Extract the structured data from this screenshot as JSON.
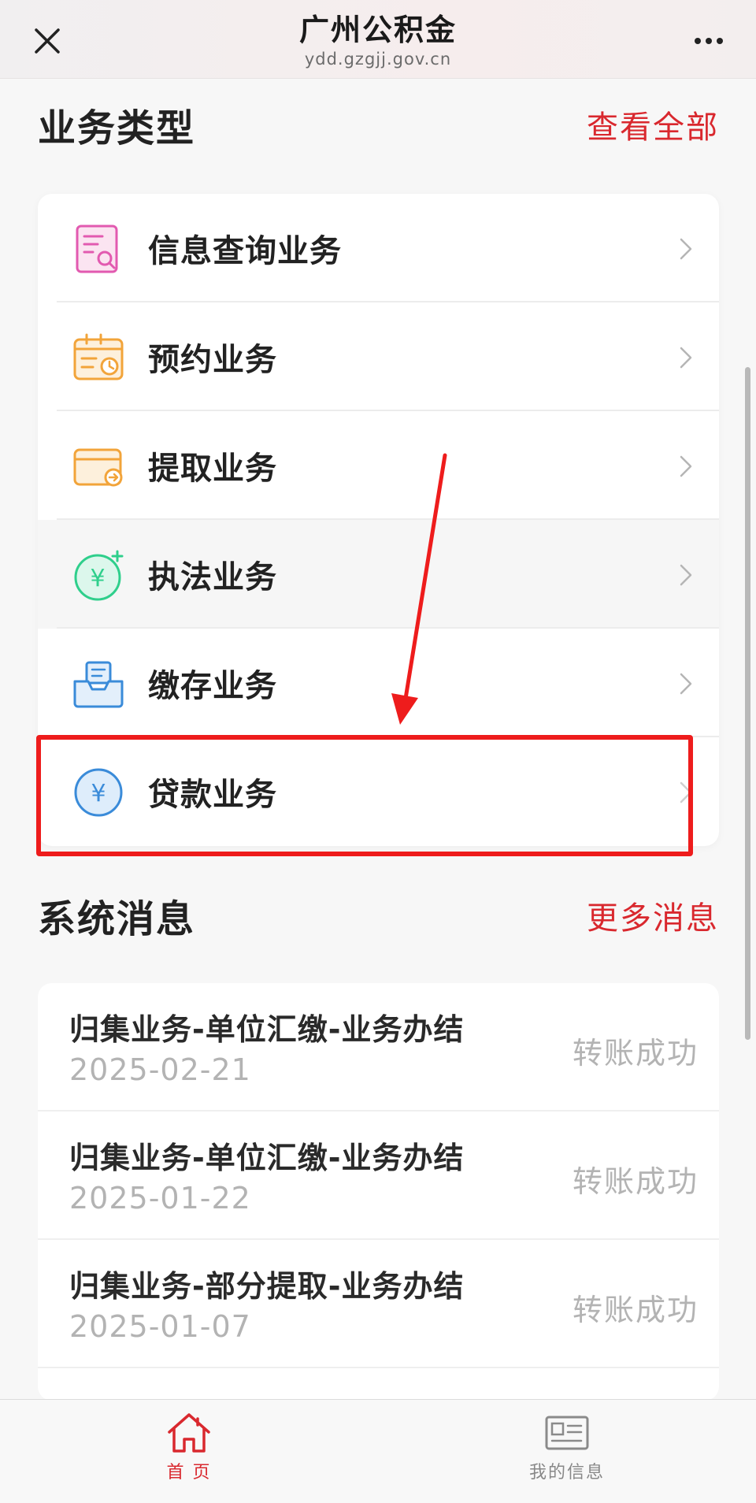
{
  "header": {
    "title": "广州公积金",
    "url": "ydd.gzgjj.gov.cn"
  },
  "business": {
    "title": "业务类型",
    "view_all": "查看全部",
    "items": [
      {
        "label": "信息查询业务",
        "icon": "document-search-icon"
      },
      {
        "label": "预约业务",
        "icon": "calendar-clock-icon"
      },
      {
        "label": "提取业务",
        "icon": "card-withdraw-icon"
      },
      {
        "label": "执法业务",
        "icon": "yuan-plus-circle-icon"
      },
      {
        "label": "缴存业务",
        "icon": "inbox-tray-icon"
      },
      {
        "label": "贷款业务",
        "icon": "yuan-circle-icon"
      }
    ]
  },
  "messages": {
    "title": "系统消息",
    "more": "更多消息",
    "items": [
      {
        "title": "归集业务-单位汇缴-业务办结",
        "date": "2025-02-21",
        "status": "转账成功"
      },
      {
        "title": "归集业务-单位汇缴-业务办结",
        "date": "2025-01-22",
        "status": "转账成功"
      },
      {
        "title": "归集业务-部分提取-业务办结",
        "date": "2025-01-07",
        "status": "转账成功"
      }
    ]
  },
  "tabbar": {
    "home": "首 页",
    "my_info": "我的信息"
  },
  "colors": {
    "accent": "#d9282e",
    "highlight": "#ee1c1c"
  }
}
